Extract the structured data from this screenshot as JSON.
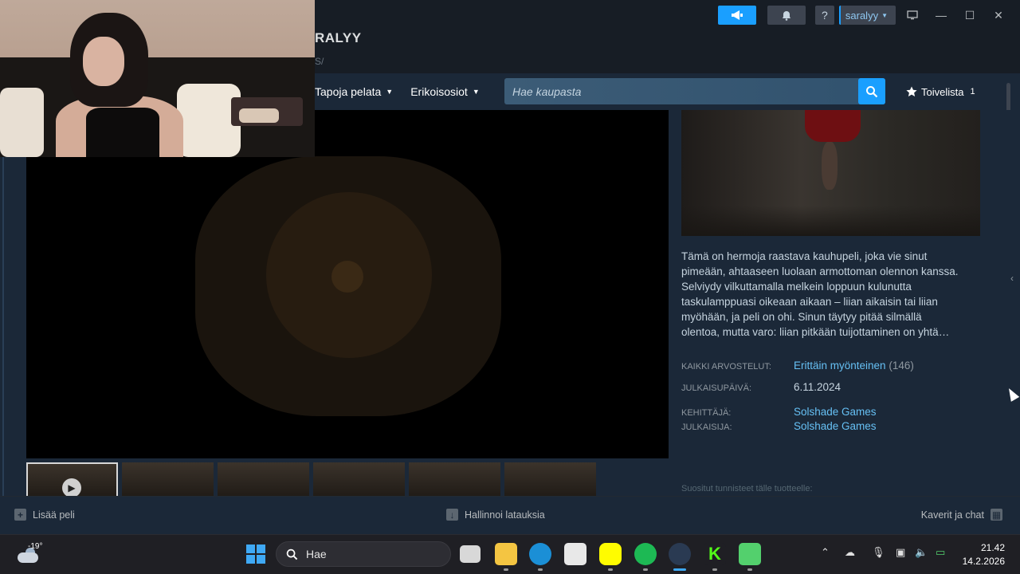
{
  "titlebar": {
    "game_title": "RALYY",
    "crumb": "S/",
    "username": "saralyy"
  },
  "store_nav": {
    "items": [
      {
        "label": "Tapoja pelata"
      },
      {
        "label": "Erikoisosiot"
      }
    ],
    "search_placeholder": "Hae kaupasta",
    "wishlist_label": "Toivelista",
    "wishlist_count": "1"
  },
  "game": {
    "description": "Tämä on hermoja raastava kauhupeli, joka vie sinut pimeään, ahtaaseen luolaan armottoman olennon kanssa. Selviydy vilkuttamalla melkein loppuun kulunutta taskulamppuasi oikeaan aikaan – liian aikaisin tai liian myöhään, ja peli on ohi. Sinun täytyy pitää silmällä olentoa, mutta varo: liian pitkään tuijottaminen on yhtä…",
    "reviews_label": "KAIKKI ARVOSTELUT:",
    "reviews_value": "Erittäin myönteinen",
    "reviews_count": "(146)",
    "release_label": "JULKAISUPÄIVÄ:",
    "release_value": "6.11.2024",
    "developer_label": "KEHITTÄJÄ:",
    "developer_value": "Solshade Games",
    "publisher_label": "JULKAISIJA:",
    "publisher_value": "Solshade Games",
    "tags_note": "Suositut tunnisteet tälle tuotteelle:"
  },
  "bottombar": {
    "add_game": "Lisää peli",
    "downloads": "Hallinnoi latauksia",
    "friends": "Kaverit ja chat"
  },
  "taskbar": {
    "temperature": "-19°",
    "search_placeholder": "Hae",
    "time": "21.42",
    "date": "14.2.2026"
  },
  "colors": {
    "steam_bg": "#1b2838",
    "accent": "#1a9fff",
    "link": "#66c0f4"
  }
}
